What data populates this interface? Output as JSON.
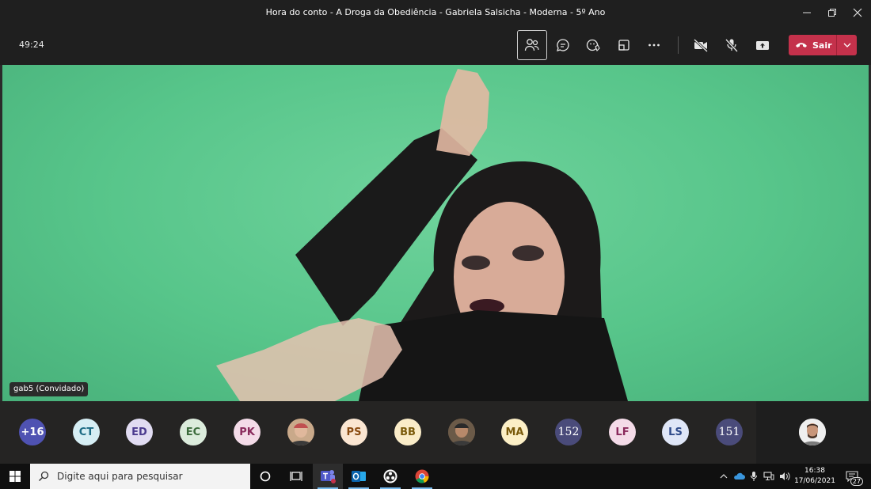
{
  "window": {
    "title": "Hora do conto - A Droga da Obediência - Gabriela Salsicha - Moderna - 5º Ano"
  },
  "toolbar": {
    "timer": "49:24",
    "leave_label": "Sair",
    "buttons": [
      "participants-icon",
      "chat-icon",
      "reactions-icon",
      "rooms-icon",
      "more-icon",
      "camera-off-icon",
      "mic-off-icon",
      "share-icon"
    ]
  },
  "video": {
    "participant_label": "gab5 (Convidado)"
  },
  "participants": [
    {
      "initials": "+16",
      "bg": "#4f52b2",
      "fg": "#ffffff"
    },
    {
      "initials": "CT",
      "bg": "#d6eef4",
      "fg": "#1c6b84"
    },
    {
      "initials": "ED",
      "bg": "#e1dcf2",
      "fg": "#4b3b8f"
    },
    {
      "initials": "EC",
      "bg": "#dcecdc",
      "fg": "#3b6b3b"
    },
    {
      "initials": "PK",
      "bg": "#f4dbe8",
      "fg": "#8a2a5c"
    },
    {
      "initials": "",
      "photo": true
    },
    {
      "initials": "PS",
      "bg": "#fbe6d2",
      "fg": "#8a4b12"
    },
    {
      "initials": "BB",
      "bg": "#faecc8",
      "fg": "#7a5a0a"
    },
    {
      "initials": "",
      "photo": true
    },
    {
      "initials": "MA",
      "bg": "#fcefc6",
      "fg": "#7a5a0a"
    },
    {
      "initials": "152",
      "bg": "#4a4b7a",
      "fg": "#ffffff",
      "badge": true
    },
    {
      "initials": "LF",
      "bg": "#f4dbe8",
      "fg": "#8a2a5c"
    },
    {
      "initials": "LS",
      "bg": "#dfe6f7",
      "fg": "#2e4a8a"
    },
    {
      "initials": "151",
      "bg": "#4a4b7a",
      "fg": "#ffffff",
      "badge": true
    }
  ],
  "taskbar": {
    "search_placeholder": "Digite aqui para pesquisar",
    "time": "16:38",
    "date": "17/06/2021",
    "notifications": "27"
  },
  "colors": {
    "leave": "#c4314b",
    "greenscreen": "#57c58a",
    "accent": "#6264a7"
  }
}
